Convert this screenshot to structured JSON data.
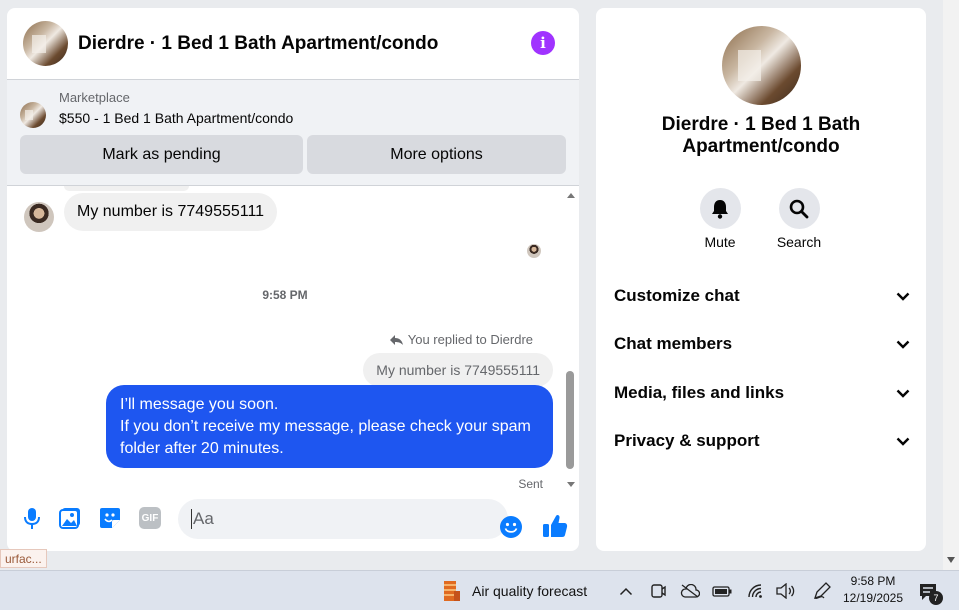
{
  "chat": {
    "header_title": "Dierdre · 1 Bed 1 Bath Apartment/condo",
    "info_glyph": "i",
    "marketplace_label": "Marketplace",
    "listing_price_title": "$550 - 1 Bed 1 Bath Apartment/condo",
    "mark_pending": "Mark as pending",
    "more_options": "More options"
  },
  "messages": {
    "incoming": "My number is 7749555111",
    "timestamp": "9:58 PM",
    "replied_to": "You replied to Dierdre",
    "quoted": "My number is 7749555111",
    "outgoing_line1": "I’ll message you soon.",
    "outgoing_line2": "If you don’t receive my message, please check your spam",
    "outgoing_line3": "folder after 20 minutes.",
    "status": "Sent"
  },
  "composer": {
    "placeholder": "Aa",
    "icons": [
      "microphone-icon",
      "photo-icon",
      "sticker-icon",
      "gif-icon",
      "emoji-icon",
      "thumbs-up-icon"
    ],
    "gif_label": "GIF"
  },
  "sidebar": {
    "name": "Dierdre · 1 Bed 1 Bath Apartment/condo",
    "mute": "Mute",
    "search": "Search",
    "sections": [
      "Customize chat",
      "Chat members",
      "Media, files and links",
      "Privacy & support"
    ]
  },
  "taskbar": {
    "weather_text": "Air quality forecast",
    "time": "9:58 PM",
    "date": "12/19/2025",
    "notif_count": "7",
    "tooltip": "urfac..."
  },
  "colors": {
    "accent": "#1e56f0",
    "info": "#a033ff",
    "like": "#0a7cff"
  }
}
